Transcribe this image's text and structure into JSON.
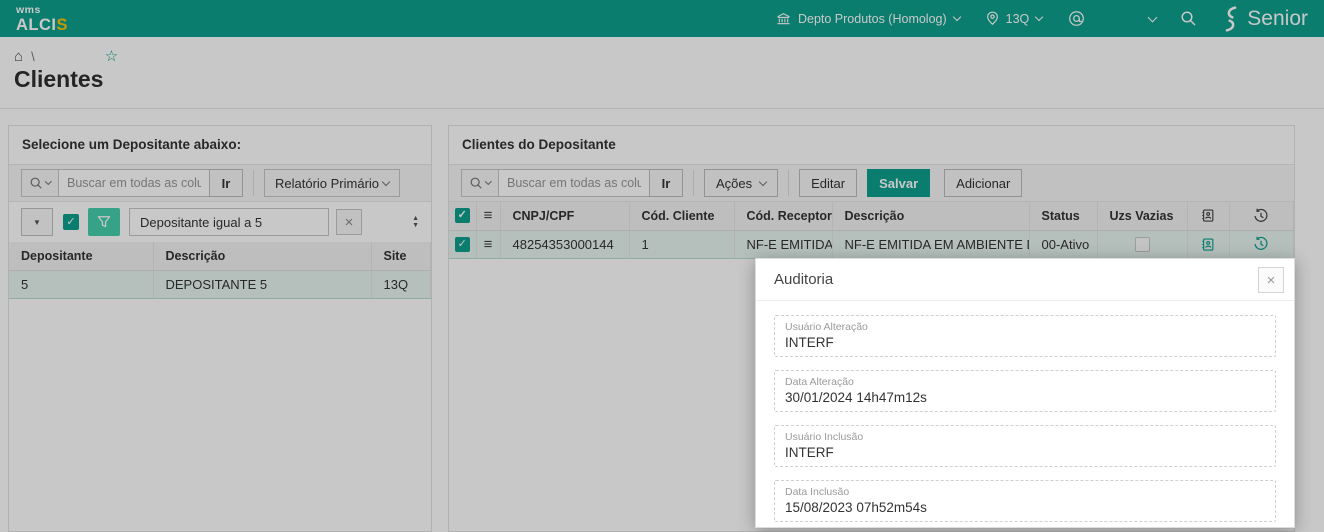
{
  "topbar": {
    "logo_wms": "wms",
    "logo_alci": "ALCI",
    "logo_s": "S",
    "department_label": "Depto Produtos (Homolog)",
    "site_label": "13Q",
    "brand_label": "Senior"
  },
  "icons": {
    "home": "⌂",
    "star": "☆",
    "caret_down": "▼",
    "spinner_up": "▲",
    "spinner_down": "▼",
    "close": "×",
    "menu": "≡"
  },
  "breadcrumb": {
    "separator": "\\"
  },
  "page_title": "Clientes",
  "left_panel": {
    "title": "Selecione um Depositante abaixo:",
    "toolbar": {
      "search_placeholder": "Buscar em todas as colunas",
      "go_label": "Ir",
      "report_value": "Relatório Primário"
    },
    "filter": {
      "value": "Depositante igual a 5",
      "checked": true
    },
    "table": {
      "col_depositante": "Depositante",
      "col_descricao": "Descrição",
      "col_site": "Site",
      "row": {
        "depositante": "5",
        "descricao": "DEPOSITANTE 5",
        "site": "13Q",
        "selected": true
      }
    }
  },
  "right_panel": {
    "title": "Clientes do Depositante",
    "toolbar": {
      "search_placeholder": "Buscar em todas as colunas",
      "go_label": "Ir",
      "actions_label": "Ações",
      "edit_label": "Editar",
      "save_label": "Salvar",
      "add_label": "Adicionar"
    },
    "table": {
      "col_cnpj": "CNPJ/CPF",
      "col_cod_cliente": "Cód. Cliente",
      "col_cod_receptor": "Cód. Receptor",
      "col_descricao": "Descrição",
      "col_status": "Status",
      "col_uzs": "Uzs Vazias",
      "row": {
        "cnpj": "48254353000144",
        "cod_cliente": "1",
        "cod_receptor": "NF-E EMITIDA EM AM...",
        "descricao": "NF-E EMITIDA EM AMBIENTE DE HOMOLO...",
        "status": "00-Ativo",
        "uzs_vazias": false,
        "selected": true
      }
    }
  },
  "modal": {
    "title": "Auditoria",
    "fields": [
      {
        "label": "Usuário Alteração",
        "value": "INTERF"
      },
      {
        "label": "Data Alteração",
        "value": "30/01/2024 14h47m12s"
      },
      {
        "label": "Usuário Inclusão",
        "value": "INTERF"
      },
      {
        "label": "Data Inclusão",
        "value": "15/08/2023 07h52m54s"
      }
    ]
  },
  "colors": {
    "brand_teal": "#0da08d",
    "accent_green": "#45cfae",
    "brand_yellow": "#ffc400",
    "selected_row": "#e7f5f1"
  }
}
